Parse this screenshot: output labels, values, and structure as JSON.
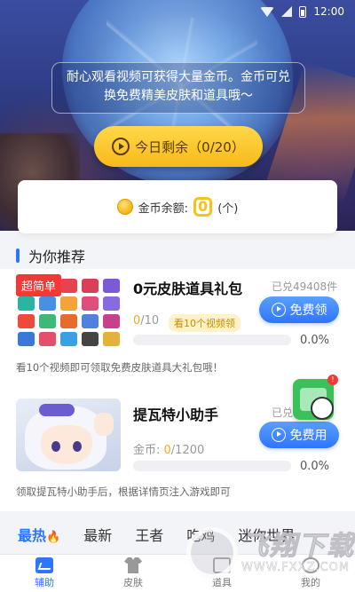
{
  "status_bar": {
    "time": "12:00"
  },
  "hero": {
    "tip": "耐心观看视频可获得大量金币。金币可兑换免费精美皮肤和道具哦～",
    "remain_button": "今日剩余（0/20）"
  },
  "balance": {
    "label": "金币余额:",
    "value": "0",
    "unit": "(个)"
  },
  "section": {
    "title": "为你推荐"
  },
  "items": [
    {
      "tag": "超简单",
      "title": "0元皮肤道具礼包",
      "sold": "已兑49408件",
      "button": "免费领",
      "progress_done": "0",
      "progress_total": "/10",
      "watch_tag": "看10个视频领",
      "progress_fraction": 0.0,
      "percent": "0.0%",
      "desc": "看10个视频即可领取免费皮肤道具大礼包哦！"
    },
    {
      "title": "提瓦特小助手",
      "sold": "已兑",
      "button": "免费用",
      "progress_label": "金币: ",
      "progress_done": "0",
      "progress_total": "/1200",
      "progress_fraction": 0.0,
      "percent": "0.0%",
      "desc": "领取提瓦特小助手后，根据详情页注入游戏即可"
    }
  ],
  "float_badge": "!",
  "categories": [
    {
      "label": "最热",
      "active": true
    },
    {
      "label": "最新"
    },
    {
      "label": "王者"
    },
    {
      "label": "吃鸡"
    },
    {
      "label": "迷你世界"
    }
  ],
  "bottom_nav": [
    {
      "label": "辅助",
      "icon": "assist-icon",
      "active": true
    },
    {
      "label": "皮肤",
      "icon": "skin-icon"
    },
    {
      "label": "道具",
      "icon": "news-icon"
    },
    {
      "label": "我的",
      "icon": "me-icon"
    }
  ],
  "watermark": {
    "brand": "飞翔下载",
    "url": "WWW.FXXZ.COM"
  },
  "colors": {
    "accent": "#2f74ff",
    "gold": "#f6c21c",
    "tag_red": "#f03a3a"
  }
}
